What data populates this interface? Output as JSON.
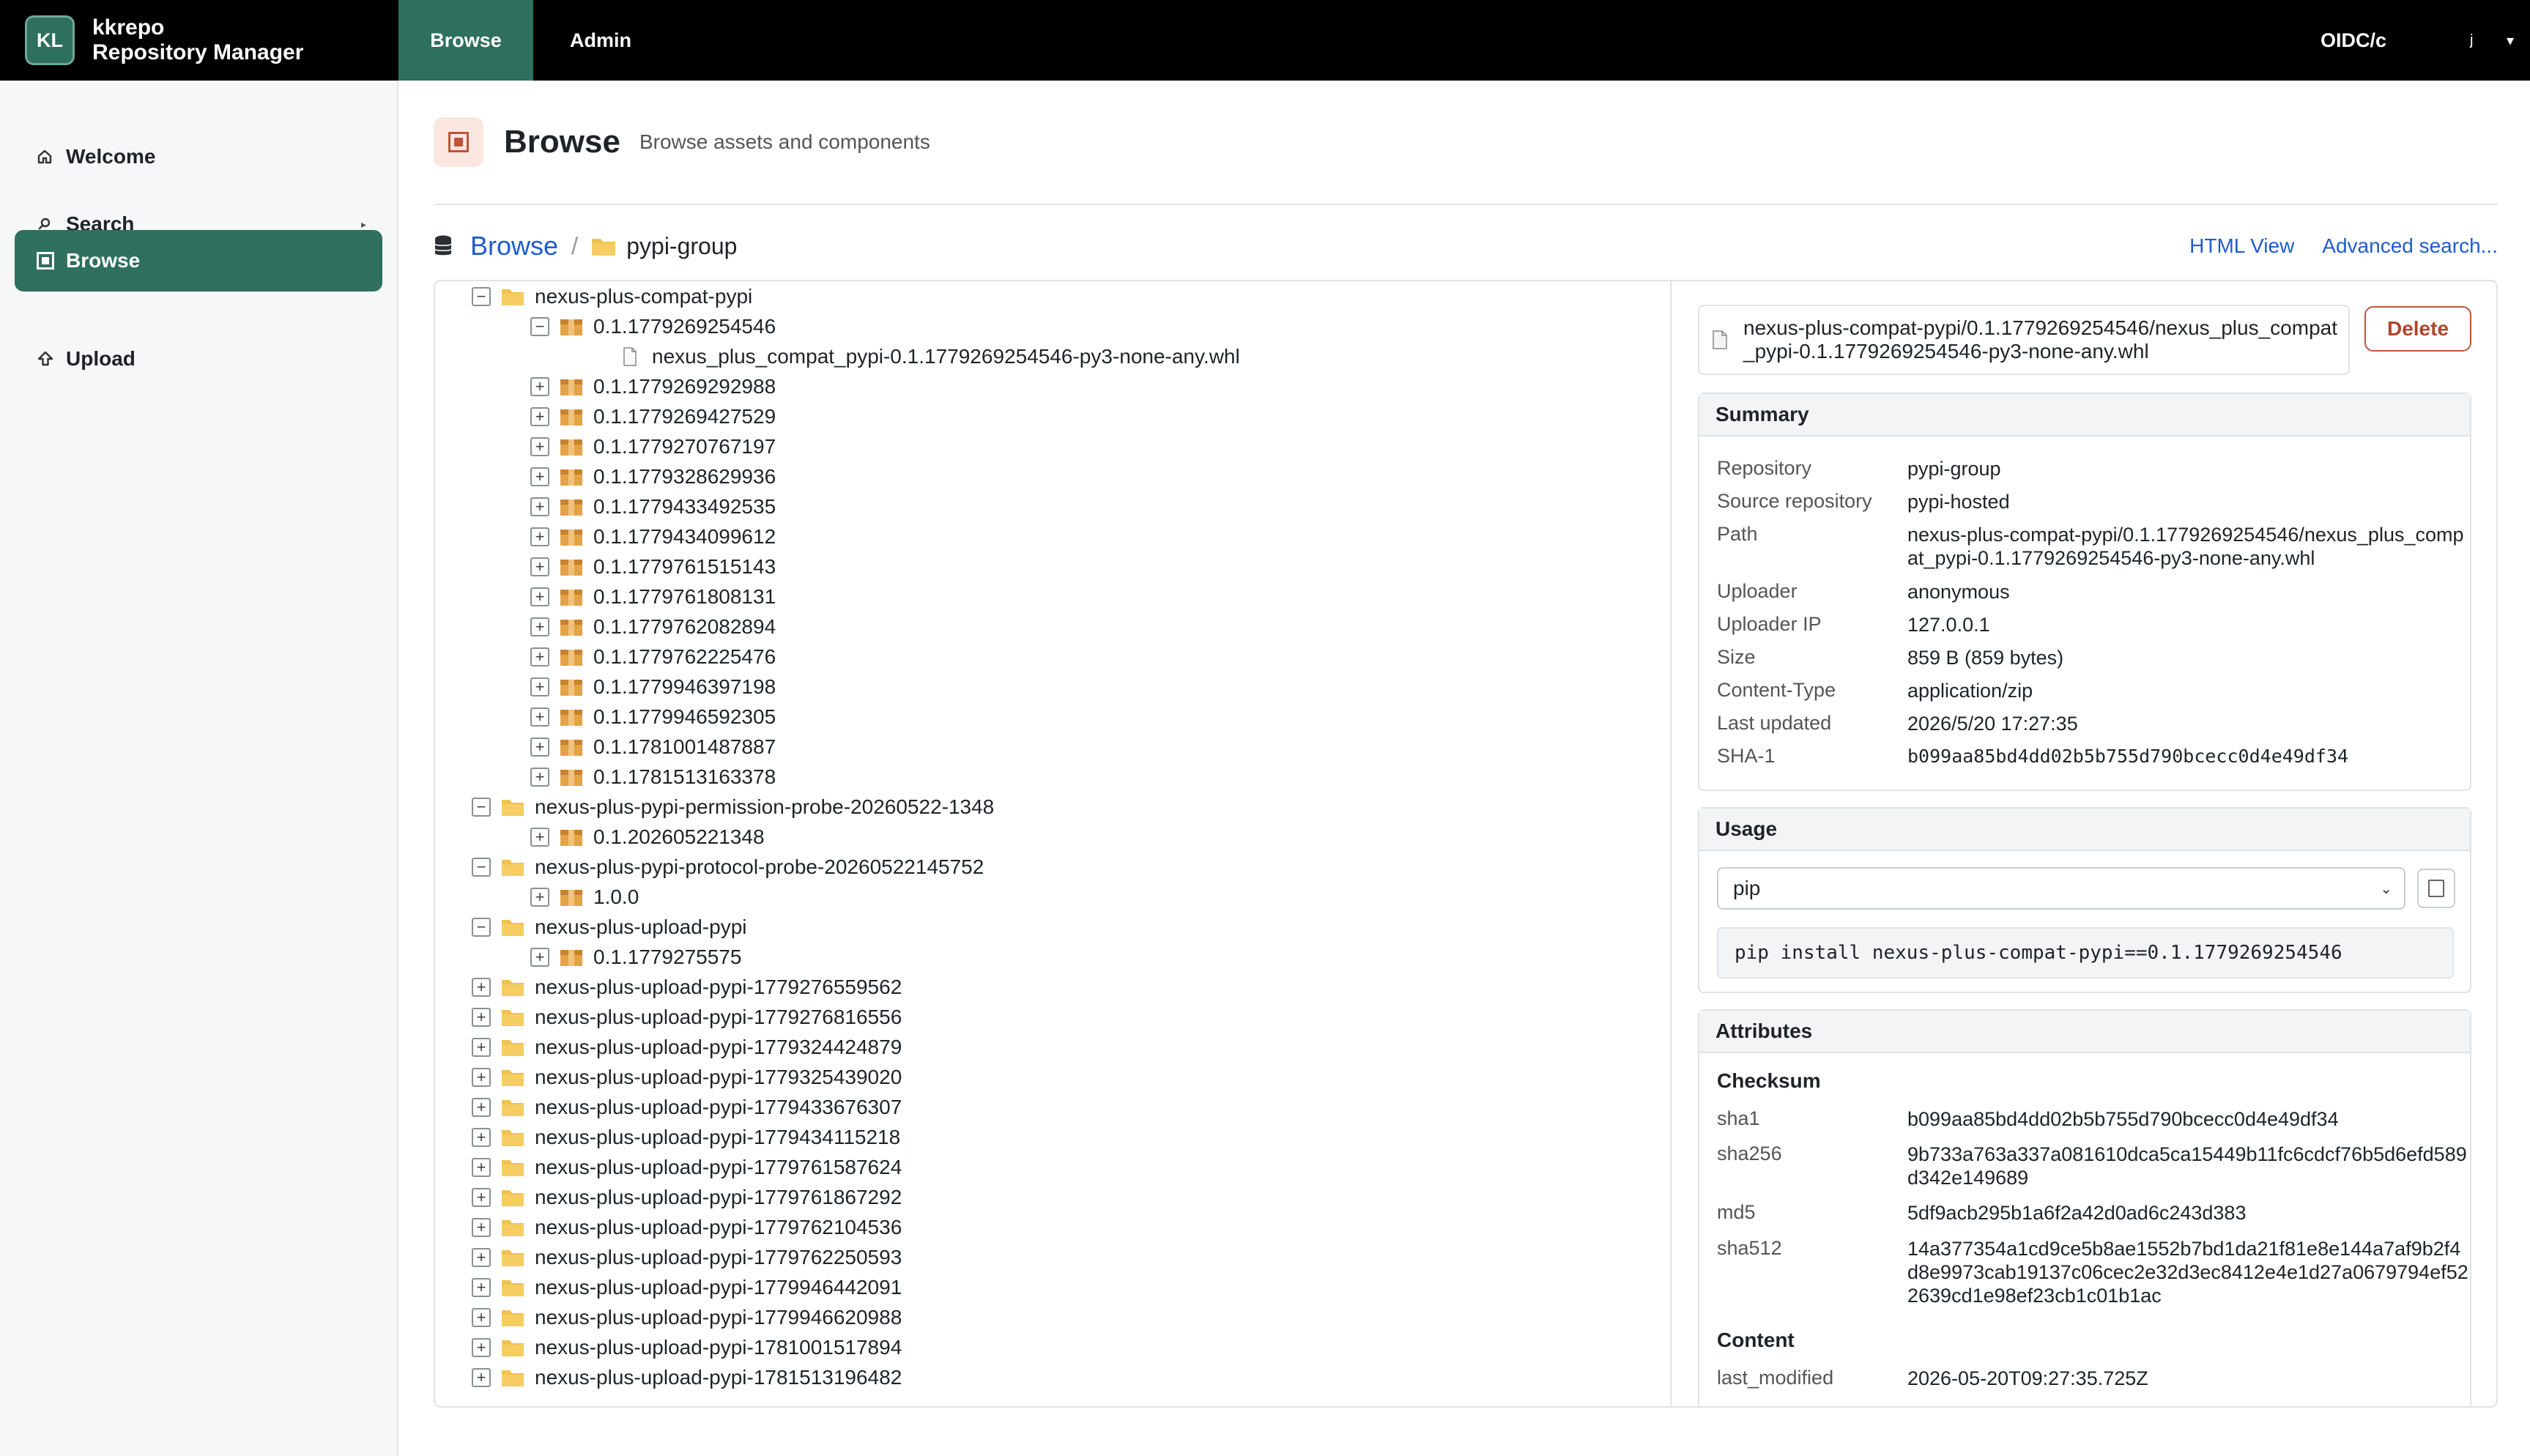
{
  "brand": {
    "logo": "KL",
    "line1": "kkrepo",
    "line2": "Repository Manager"
  },
  "topnav": {
    "browse": "Browse",
    "admin": "Admin"
  },
  "user": {
    "label": "OIDC/c",
    "glyph": "j",
    "caret": "▾"
  },
  "sidebar": {
    "items": [
      {
        "label": "Welcome",
        "icon": "home-icon"
      },
      {
        "label": "Search",
        "icon": "search-icon"
      },
      {
        "label": "Browse",
        "icon": "browse-icon"
      },
      {
        "label": "Upload",
        "icon": "upload-icon"
      }
    ]
  },
  "page": {
    "title": "Browse",
    "subtitle": "Browse assets and components"
  },
  "breadcrumb": {
    "root": "Browse",
    "sep": "/",
    "current": "pypi-group"
  },
  "actions": {
    "html_view": "HTML View",
    "advanced_search": "Advanced search..."
  },
  "tree": {
    "rows": [
      {
        "label": "nexus-plus-compat-pypi",
        "toggle": "−",
        "type": "folder",
        "level": 0
      },
      {
        "label": "0.1.1779269254546",
        "toggle": "−",
        "type": "package",
        "level": 1
      },
      {
        "label": "nexus_plus_compat_pypi-0.1.1779269254546-py3-none-any.whl",
        "toggle": "",
        "type": "file",
        "level": 2,
        "selected": true
      },
      {
        "label": "0.1.1779269292988",
        "toggle": "+",
        "type": "package",
        "level": 1
      },
      {
        "label": "0.1.1779269427529",
        "toggle": "+",
        "type": "package",
        "level": 1
      },
      {
        "label": "0.1.1779270767197",
        "toggle": "+",
        "type": "package",
        "level": 1
      },
      {
        "label": "0.1.1779328629936",
        "toggle": "+",
        "type": "package",
        "level": 1
      },
      {
        "label": "0.1.1779433492535",
        "toggle": "+",
        "type": "package",
        "level": 1
      },
      {
        "label": "0.1.1779434099612",
        "toggle": "+",
        "type": "package",
        "level": 1
      },
      {
        "label": "0.1.1779761515143",
        "toggle": "+",
        "type": "package",
        "level": 1
      },
      {
        "label": "0.1.1779761808131",
        "toggle": "+",
        "type": "package",
        "level": 1
      },
      {
        "label": "0.1.1779762082894",
        "toggle": "+",
        "type": "package",
        "level": 1
      },
      {
        "label": "0.1.1779762225476",
        "toggle": "+",
        "type": "package",
        "level": 1
      },
      {
        "label": "0.1.1779946397198",
        "toggle": "+",
        "type": "package",
        "level": 1
      },
      {
        "label": "0.1.1779946592305",
        "toggle": "+",
        "type": "package",
        "level": 1
      },
      {
        "label": "0.1.1781001487887",
        "toggle": "+",
        "type": "package",
        "level": 1
      },
      {
        "label": "0.1.1781513163378",
        "toggle": "+",
        "type": "package",
        "level": 1
      },
      {
        "label": "nexus-plus-pypi-permission-probe-20260522-1348",
        "toggle": "−",
        "type": "folder",
        "level": 0
      },
      {
        "label": "0.1.202605221348",
        "toggle": "+",
        "type": "package",
        "level": 1
      },
      {
        "label": "nexus-plus-pypi-protocol-probe-20260522145752",
        "toggle": "−",
        "type": "folder",
        "level": 0
      },
      {
        "label": "1.0.0",
        "toggle": "+",
        "type": "package",
        "level": 1
      },
      {
        "label": "nexus-plus-upload-pypi",
        "toggle": "−",
        "type": "folder",
        "level": 0
      },
      {
        "label": "0.1.1779275575",
        "toggle": "+",
        "type": "package",
        "level": 1
      },
      {
        "label": "nexus-plus-upload-pypi-1779276559562",
        "toggle": "+",
        "type": "folder",
        "level": 0
      },
      {
        "label": "nexus-plus-upload-pypi-1779276816556",
        "toggle": "+",
        "type": "folder",
        "level": 0
      },
      {
        "label": "nexus-plus-upload-pypi-1779324424879",
        "toggle": "+",
        "type": "folder",
        "level": 0
      },
      {
        "label": "nexus-plus-upload-pypi-1779325439020",
        "toggle": "+",
        "type": "folder",
        "level": 0
      },
      {
        "label": "nexus-plus-upload-pypi-1779433676307",
        "toggle": "+",
        "type": "folder",
        "level": 0
      },
      {
        "label": "nexus-plus-upload-pypi-1779434115218",
        "toggle": "+",
        "type": "folder",
        "level": 0
      },
      {
        "label": "nexus-plus-upload-pypi-1779761587624",
        "toggle": "+",
        "type": "folder",
        "level": 0
      },
      {
        "label": "nexus-plus-upload-pypi-1779761867292",
        "toggle": "+",
        "type": "folder",
        "level": 0
      },
      {
        "label": "nexus-plus-upload-pypi-1779762104536",
        "toggle": "+",
        "type": "folder",
        "level": 0
      },
      {
        "label": "nexus-plus-upload-pypi-1779762250593",
        "toggle": "+",
        "type": "folder",
        "level": 0
      },
      {
        "label": "nexus-plus-upload-pypi-1779946442091",
        "toggle": "+",
        "type": "folder",
        "level": 0
      },
      {
        "label": "nexus-plus-upload-pypi-1779946620988",
        "toggle": "+",
        "type": "folder",
        "level": 0
      },
      {
        "label": "nexus-plus-upload-pypi-1781001517894",
        "toggle": "+",
        "type": "folder",
        "level": 0
      },
      {
        "label": "nexus-plus-upload-pypi-1781513196482",
        "toggle": "+",
        "type": "folder",
        "level": 0
      }
    ]
  },
  "asset": {
    "path": "nexus-plus-compat-pypi/0.1.1779269254546/nexus_plus_compat_pypi-0.1.1779269254546-py3-none-any.whl",
    "delete_label": "Delete"
  },
  "summary": {
    "title": "Summary",
    "rows": [
      {
        "k": "Repository",
        "v": "pypi-group"
      },
      {
        "k": "Source repository",
        "v": "pypi-hosted"
      },
      {
        "k": "Path",
        "v": "nexus-plus-compat-pypi/0.1.1779269254546/nexus_plus_compat_pypi-0.1.1779269254546-py3-none-any.whl"
      },
      {
        "k": "Uploader",
        "v": "anonymous"
      },
      {
        "k": "Uploader IP",
        "v": "127.0.0.1"
      },
      {
        "k": "Size",
        "v": "859 B (859 bytes)"
      },
      {
        "k": "Content-Type",
        "v": "application/zip"
      },
      {
        "k": "Last updated",
        "v": "2026/5/20 17:27:35"
      },
      {
        "k": "SHA-1",
        "v": "b099aa85bd4dd02b5b755d790bcecc0d4e49df34"
      }
    ]
  },
  "usage": {
    "title": "Usage",
    "selected": "pip",
    "command": "pip install nexus-plus-compat-pypi==0.1.1779269254546"
  },
  "attributes": {
    "title": "Attributes",
    "checksum_title": "Checksum",
    "checksum": [
      {
        "k": "sha1",
        "v": "b099aa85bd4dd02b5b755d790bcecc0d4e49df34"
      },
      {
        "k": "sha256",
        "v": "9b733a763a337a081610dca5ca15449b11fc6cdcf76b5d6efd589d342e149689"
      },
      {
        "k": "md5",
        "v": "5df9acb295b1a6f2a42d0ad6c243d383"
      },
      {
        "k": "sha512",
        "v": "14a377354a1cd9ce5b8ae1552b7bd1da21f81e8e144a7af9b2f4d8e9973cab19137c06cec2e32d3ec8412e4e1d27a0679794ef522639cd1e98ef23cb1c01b1ac"
      }
    ],
    "content_title": "Content",
    "content": [
      {
        "k": "last_modified",
        "v": "2026-05-20T09:27:35.725Z"
      }
    ]
  },
  "colors": {
    "accent": "#2f6f5e",
    "link": "#1f5bd1",
    "danger": "#c0533a",
    "package": "#e3a34a",
    "folder": "#f2c14e"
  }
}
